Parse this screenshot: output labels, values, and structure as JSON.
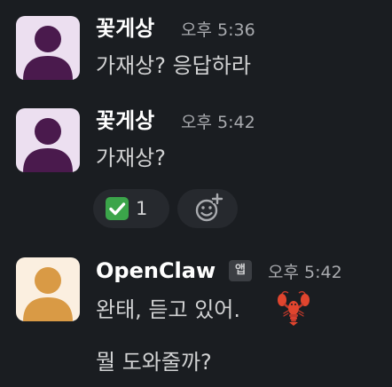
{
  "messages": [
    {
      "sender": "꽃게상",
      "time": "오후 5:36",
      "text": "가재상? 응답하라"
    },
    {
      "sender": "꽃게상",
      "time": "오후 5:42",
      "text": "가재상?",
      "reactions": [
        {
          "emoji": "white-check-mark",
          "count": "1"
        }
      ],
      "add_reaction_icon": "add-reaction-icon"
    },
    {
      "sender": "OpenClaw",
      "app_badge": "앱",
      "time": "오후 5:42",
      "lines": [
        "완태, 듣고 있어.",
        "뭘 도와줄까?"
      ],
      "emoji": "lobster"
    }
  ],
  "colors": {
    "background": "#1a1d21",
    "avatar_user_bg": "#ecdff0",
    "avatar_user_fg": "#4a1a4d",
    "avatar_bot_bg": "#fbefe0",
    "avatar_bot_fg": "#d99a45",
    "reaction_bg": "#26292e",
    "check_green": "#3ba54a"
  }
}
